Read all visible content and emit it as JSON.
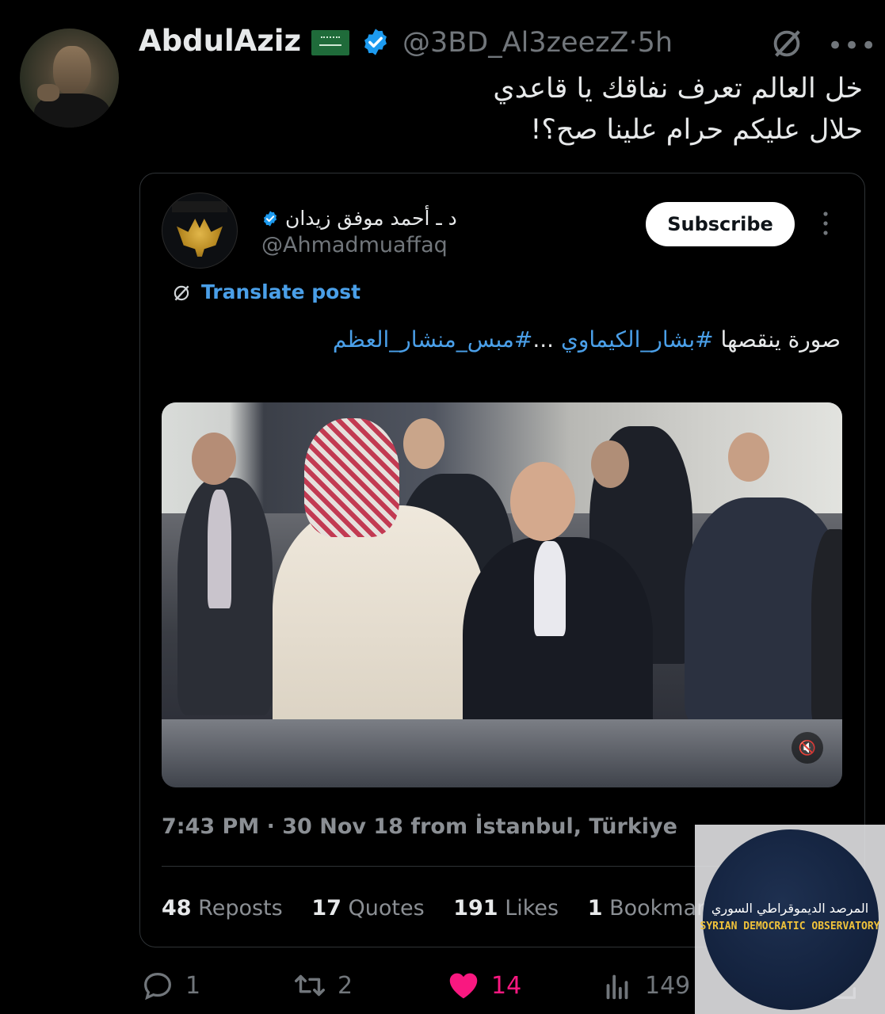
{
  "tweet": {
    "author_name": "AbdulAziz",
    "flag": "saudi-flag",
    "verified": true,
    "handle": "@3BD_Al3zeezZ",
    "time_sep": "·",
    "age": "5h",
    "text_line1": "خل العالم تعرف نفاقك يا قاعدي",
    "text_line2": "حلال عليكم حرام علينا صح؟!"
  },
  "quoted": {
    "author_name": "د ـ أحمد موفق زيدان",
    "handle": "@Ahmadmuaffaq",
    "subscribe_label": "Subscribe",
    "translate_label": "Translate post",
    "text_plain": "صورة ينقصها ",
    "hashtag1": "#بشار_الكيماوي",
    "ellipsis": " ...",
    "hashtag2": "#مبس_منشار_العظم",
    "timestamp": "7:43 PM · 30 Nov 18 from İstanbul, Türkiye",
    "stats": {
      "reposts_count": "48",
      "reposts_label": "Reposts",
      "quotes_count": "17",
      "quotes_label": "Quotes",
      "likes_count": "191",
      "likes_label": "Likes",
      "bookmarks_count": "1",
      "bookmarks_label": "Bookmar"
    },
    "video_muted_icon": "volume-muted-icon"
  },
  "actions": {
    "replies": "1",
    "reposts": "2",
    "likes": "14",
    "views": "149"
  },
  "watermark": {
    "arabic": "المرصد الديموقراطي السوري",
    "english": "SYRIAN DEMOCRATIC OBSERVATORY"
  },
  "colors": {
    "background": "#000000",
    "text": "#e7e9ea",
    "muted": "#71767b",
    "link": "#4a9fe8",
    "like": "#f91880",
    "verified": "#1d9bf0"
  }
}
